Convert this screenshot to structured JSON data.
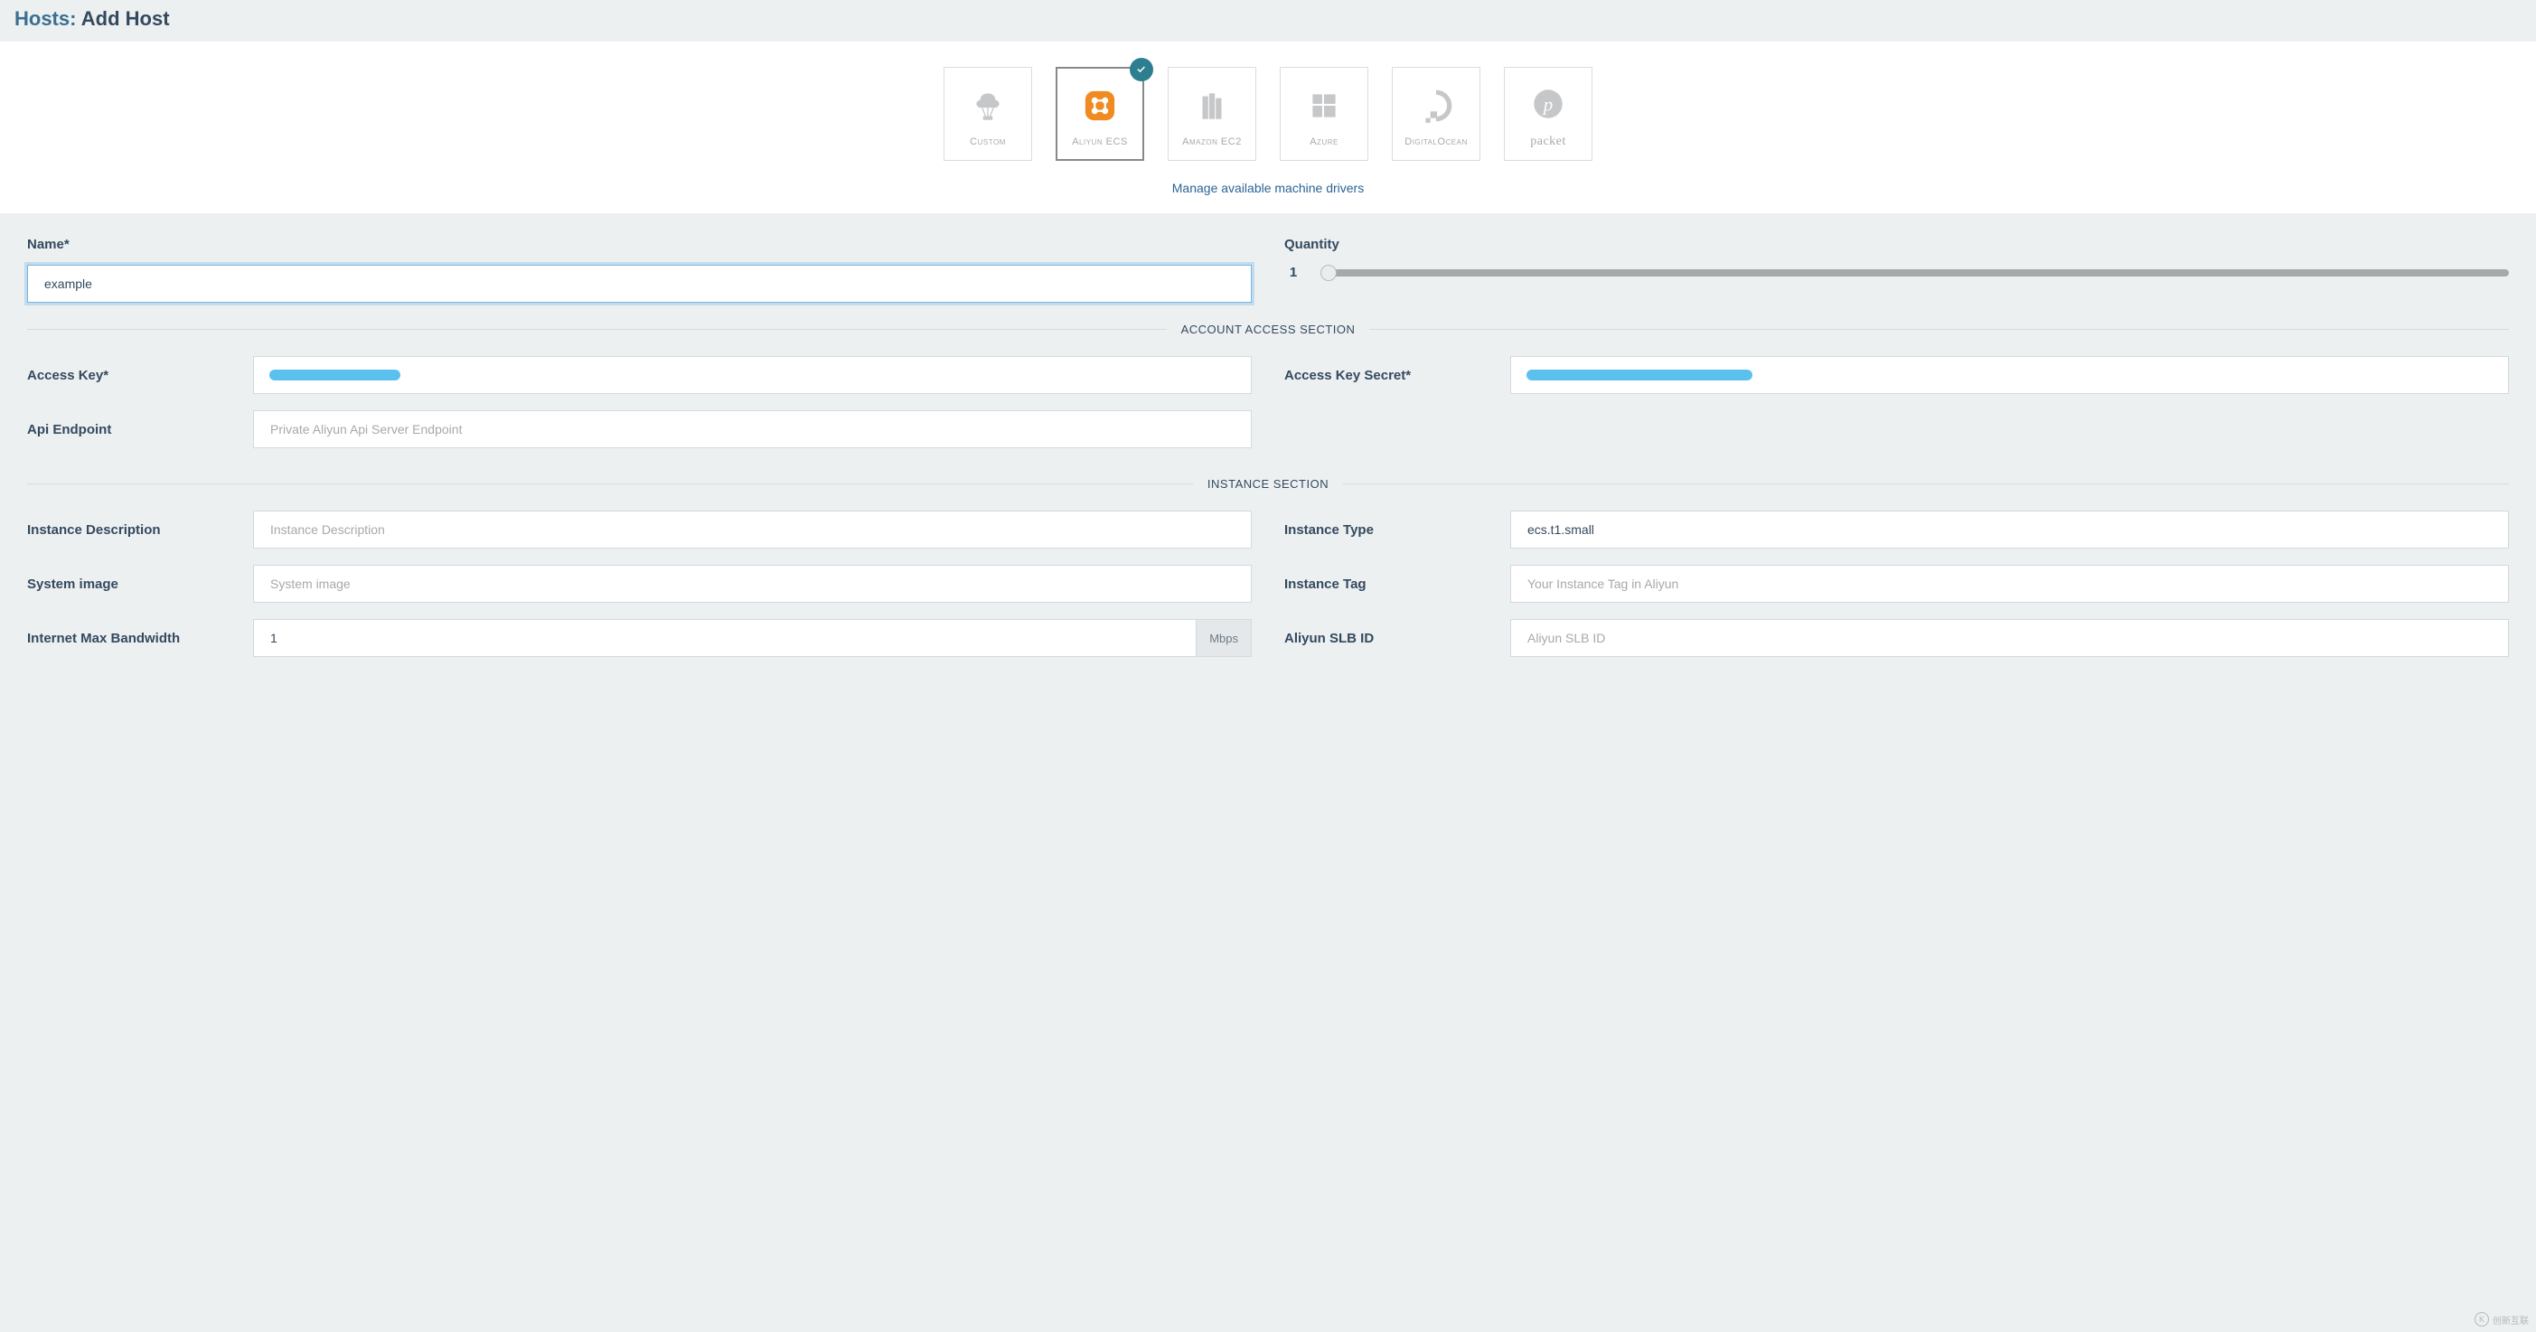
{
  "breadcrumb": {
    "parent": "Hosts:",
    "current": "Add Host"
  },
  "drivers": {
    "custom": "Custom",
    "aliyun": "Aliyun ECS",
    "amazon": "Amazon EC2",
    "azure": "Azure",
    "digitalocean": "DigitalOcean",
    "packet": "packet"
  },
  "manage_link": "Manage available machine drivers",
  "labels": {
    "name": "Name*",
    "quantity": "Quantity",
    "access_key": "Access Key*",
    "access_key_secret": "Access Key Secret*",
    "api_endpoint": "Api Endpoint",
    "instance_description": "Instance Description",
    "instance_type": "Instance Type",
    "system_image": "System image",
    "instance_tag": "Instance Tag",
    "internet_max_bandwidth": "Internet Max Bandwidth",
    "aliyun_slb_id": "Aliyun SLB ID"
  },
  "sections": {
    "account": "ACCOUNT ACCESS SECTION",
    "instance": "INSTANCE SECTION"
  },
  "values": {
    "name": "example",
    "quantity": "1",
    "instance_type": "ecs.t1.small",
    "bandwidth": "1"
  },
  "placeholders": {
    "api_endpoint": "Private Aliyun Api Server Endpoint",
    "instance_description": "Instance Description",
    "system_image": "System image",
    "instance_tag": "Your Instance Tag in Aliyun",
    "aliyun_slb_id": "Aliyun SLB ID"
  },
  "units": {
    "mbps": "Mbps"
  },
  "watermark": "创新互联"
}
